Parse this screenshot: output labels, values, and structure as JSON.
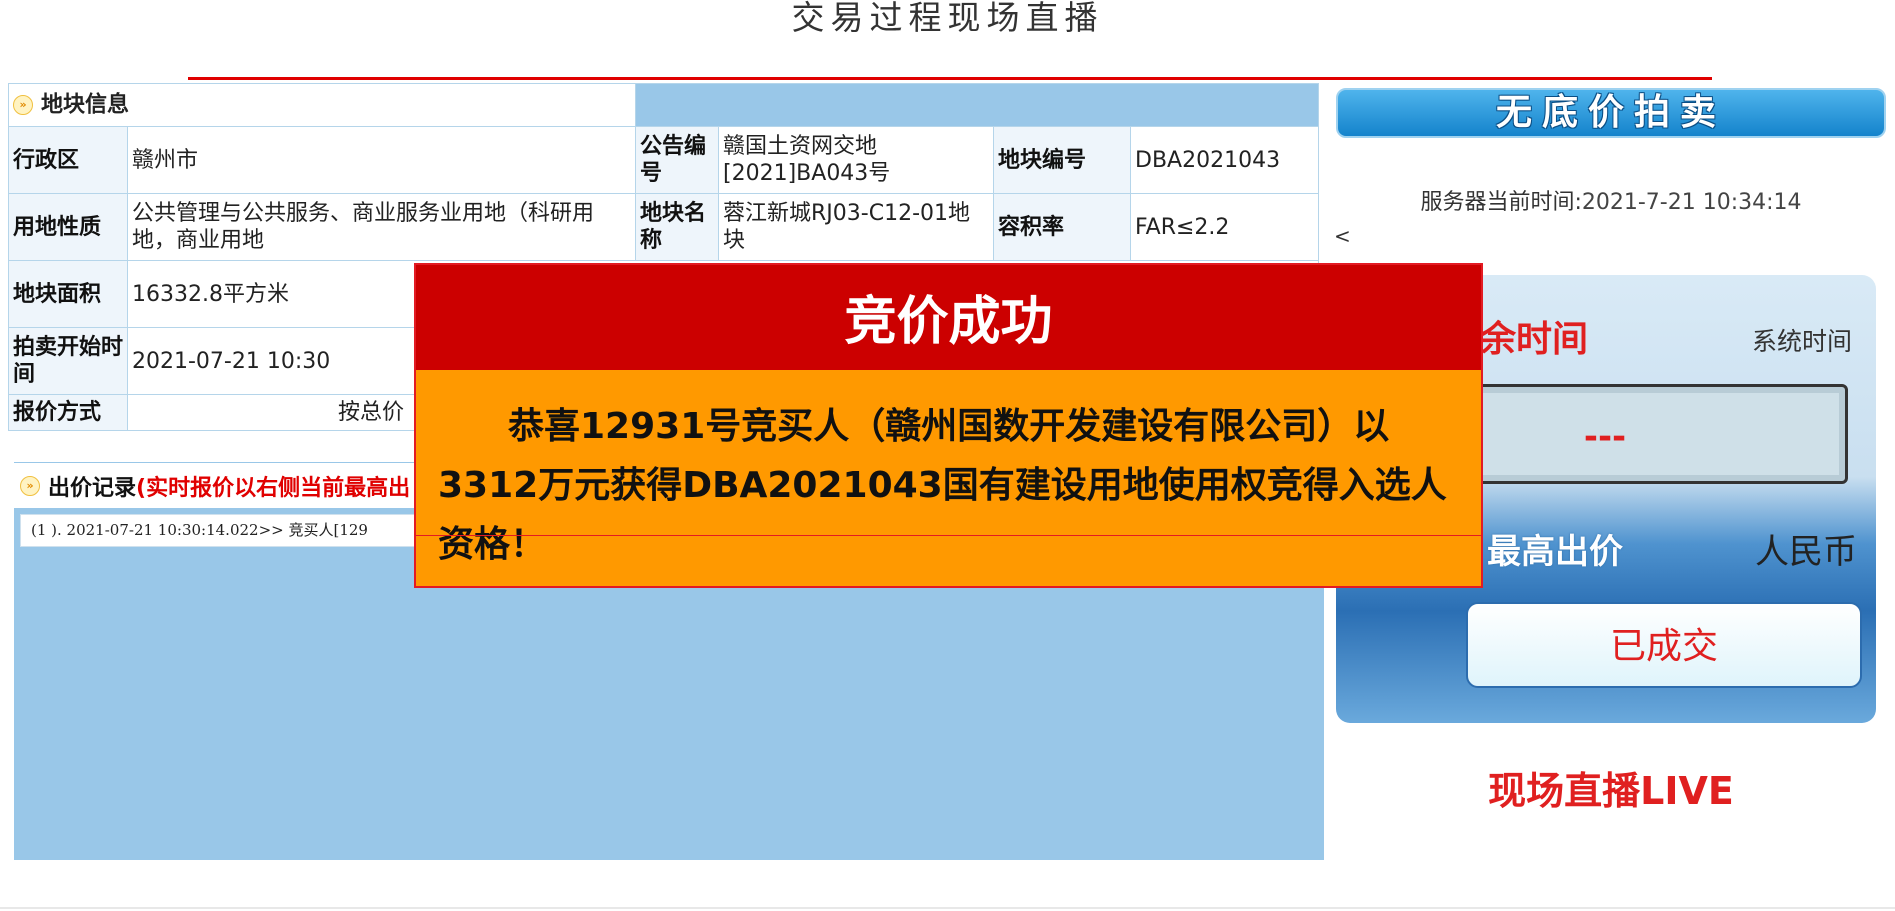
{
  "page": {
    "title": "交易过程现场直播"
  },
  "parcel_info": {
    "section_title": "地块信息",
    "rows": [
      {
        "cells": [
          {
            "label": "行政区",
            "value": "赣州市"
          },
          {
            "label": "公告编号",
            "value": "赣国土资网交地[2021]BA043号"
          },
          {
            "label": "地块编号",
            "value": "DBA2021043"
          }
        ]
      },
      {
        "cells": [
          {
            "label": "用地性质",
            "value": "公共管理与公共服务、商业服务业用地（科研用地，商业用地"
          },
          {
            "label": "地块名称",
            "value": "蓉江新城RJ03-C12-01地块"
          },
          {
            "label": "容积率",
            "value": "FAR≤2.2"
          }
        ]
      },
      {
        "cells": [
          {
            "label": "地块面积",
            "value": "16332.8平方米"
          }
        ]
      },
      {
        "cells": [
          {
            "label": "拍卖开始时间",
            "value": "2021-07-21 10:30"
          }
        ]
      },
      {
        "cells": [
          {
            "label": "报价方式",
            "value": "按总价"
          }
        ]
      }
    ]
  },
  "bid_records": {
    "title": "出价记录",
    "subtitle": "(实时报价以右侧当前最高出",
    "log_line": "(1 ). 2021-07-21 10:30:14.022>> 竞买人[129"
  },
  "right_panel": {
    "banner": "无底价拍卖",
    "server_time_label": "服务器当前时间:",
    "server_time_value": "2021-7-21 10:34:14",
    "arrow": "<",
    "countdown_label": "余时间",
    "system_time_label": "系统时间",
    "countdown_value": "---",
    "highest_label": "最高出价",
    "currency_label": "人民币",
    "price_status": "已成交",
    "live_label": "现场直播LIVE"
  },
  "modal": {
    "title": "竞价成功",
    "message": "恭喜12931号竞买人（赣州国数开发建设有限公司）以3312万元获得DBA2021043国有建设用地使用权竞得入选人资格！"
  },
  "colors": {
    "accent_red": "#cc0000",
    "modal_orange": "#ff9900",
    "panel_blue": "#99c7e8",
    "banner_blue": "#1483cc"
  },
  "icons": {
    "section": "arrow-bullet-icon"
  }
}
